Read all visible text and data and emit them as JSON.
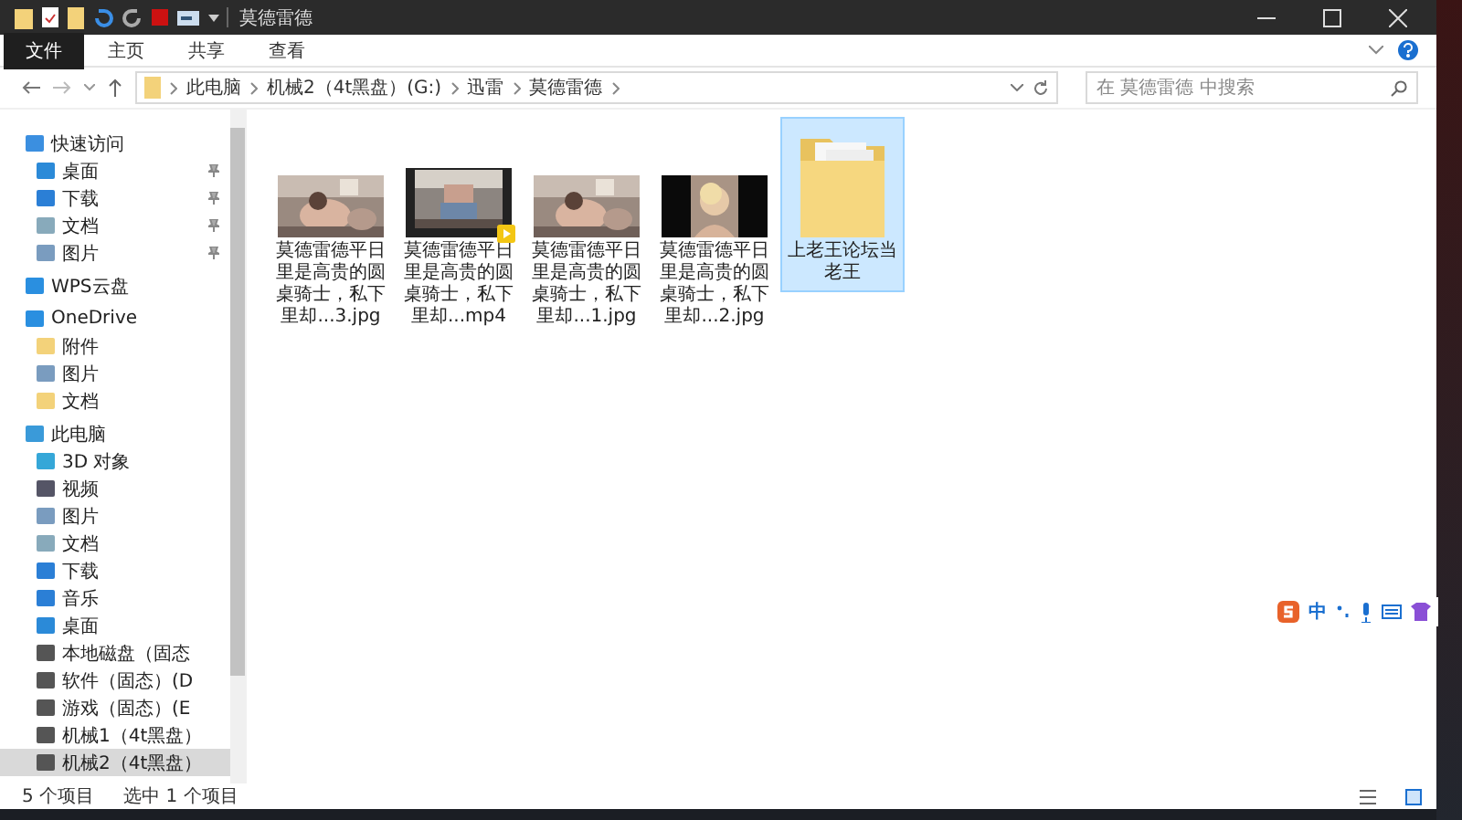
{
  "window": {
    "title": "莫德雷德"
  },
  "ribbon_tabs": [
    {
      "label": "文件",
      "kind": "file"
    },
    {
      "label": "主页",
      "kind": "tab"
    },
    {
      "label": "共享",
      "kind": "tab"
    },
    {
      "label": "查看",
      "kind": "tab"
    }
  ],
  "address": {
    "path": [
      "此电脑",
      "机械2（4t黑盘）(G:)",
      "迅雷",
      "莫德雷德"
    ]
  },
  "search": {
    "placeholder": "在 莫德雷德 中搜索"
  },
  "sidebar": {
    "items": [
      {
        "label": "快速访问",
        "kind": "star",
        "selected": false,
        "children": [
          {
            "label": "桌面",
            "kind": "desktop",
            "pinned": true,
            "selected": false
          },
          {
            "label": "下载",
            "kind": "download",
            "pinned": true,
            "selected": false
          },
          {
            "label": "文档",
            "kind": "document",
            "pinned": true,
            "selected": false
          },
          {
            "label": "图片",
            "kind": "pictures",
            "pinned": true,
            "selected": false
          }
        ]
      },
      {
        "label": "WPS云盘",
        "kind": "cloud",
        "selected": false
      },
      {
        "label": "OneDrive",
        "kind": "cloud",
        "selected": false,
        "children": [
          {
            "label": "附件",
            "kind": "folder",
            "selected": false
          },
          {
            "label": "图片",
            "kind": "pictures",
            "selected": false
          },
          {
            "label": "文档",
            "kind": "folder",
            "selected": false
          }
        ]
      },
      {
        "label": "此电脑",
        "kind": "pc",
        "selected": false,
        "children": [
          {
            "label": "3D 对象",
            "kind": "cube",
            "selected": false
          },
          {
            "label": "视频",
            "kind": "video",
            "selected": false
          },
          {
            "label": "图片",
            "kind": "pictures",
            "selected": false
          },
          {
            "label": "文档",
            "kind": "document",
            "selected": false
          },
          {
            "label": "下载",
            "kind": "download",
            "selected": false
          },
          {
            "label": "音乐",
            "kind": "music",
            "selected": false
          },
          {
            "label": "桌面",
            "kind": "desktop",
            "selected": false
          },
          {
            "label": "本地磁盘（固态",
            "kind": "sysdrive",
            "selected": false
          },
          {
            "label": "软件（固态）(D",
            "kind": "drive",
            "selected": false
          },
          {
            "label": "游戏（固态）(E",
            "kind": "drive",
            "selected": false
          },
          {
            "label": "机械1（4t黑盘）",
            "kind": "drive",
            "selected": false
          },
          {
            "label": "机械2（4t黑盘）",
            "kind": "drive",
            "selected": true
          }
        ]
      }
    ]
  },
  "files": [
    {
      "name": "莫德雷德平日里是高贵的圆桌骑士，私下里却...3.jpg",
      "selected": false
    },
    {
      "name": "莫德雷德平日里是高贵的圆桌骑士，私下里却...mp4",
      "kind": "video",
      "selected": false
    },
    {
      "name": "莫德雷德平日里是高贵的圆桌骑士，私下里却...1.jpg",
      "selected": false
    },
    {
      "name": "莫德雷德平日里是高贵的圆桌骑士，私下里却...2.jpg",
      "kind": "portrait",
      "selected": false
    },
    {
      "name": "上老王论坛当老王",
      "kind": "folder",
      "selected": true
    }
  ],
  "status_bar": {
    "count": "5 个项目",
    "selection": "选中 1 个项目"
  },
  "ime_bar": {
    "mode": "中"
  }
}
